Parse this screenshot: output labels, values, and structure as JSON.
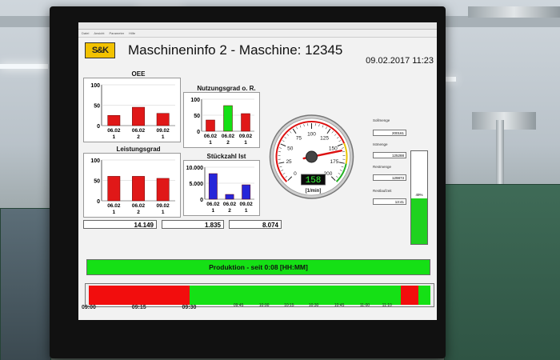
{
  "menu": [
    "Datei",
    "Ansicht",
    "Parameter",
    "Hilfe"
  ],
  "logo_text": "S&K",
  "app_title": "Maschineninfo 2 - Maschine: 12345",
  "datetime": "09.02.2017 11:23",
  "charts": [
    {
      "title": "OEE",
      "y_ticks": [
        "100",
        "50",
        "0"
      ],
      "categories": [
        "06.02\n1",
        "06.02\n2",
        "09.02\n1"
      ],
      "cat_top": [
        "06.02",
        "06.02",
        "09.02"
      ],
      "cat_bottom": [
        "1",
        "2",
        "1"
      ],
      "values": [
        25,
        45,
        30
      ],
      "color": "#e01818",
      "highlight": null
    },
    {
      "title": "Nutzungsgrad o. R.",
      "y_ticks": [
        "100",
        "50",
        "0"
      ],
      "cat_top": [
        "06.02",
        "06.02",
        "09.02"
      ],
      "cat_bottom": [
        "1",
        "2",
        "1"
      ],
      "values": [
        35,
        80,
        55
      ],
      "color": "#e01818",
      "highlight": 1
    },
    {
      "title": "Leistungsgrad",
      "y_ticks": [
        "100",
        "50",
        "0"
      ],
      "cat_top": [
        "06.02",
        "06.02",
        "09.02"
      ],
      "cat_bottom": [
        "1",
        "2",
        "1"
      ],
      "values": [
        60,
        60,
        55
      ],
      "color": "#e01818",
      "highlight": null
    },
    {
      "title": "Stückzahl Ist",
      "y_ticks": [
        "10.000",
        "5.000",
        "0"
      ],
      "cat_top": [
        "06.02",
        "06.02",
        "09.02"
      ],
      "cat_bottom": [
        "1",
        "2",
        "1"
      ],
      "values": [
        8000,
        1500,
        4500
      ],
      "color": "#2626d9",
      "highlight": null
    }
  ],
  "value_boxes": [
    "14.149",
    "1.835",
    "8.074"
  ],
  "gauge": {
    "ticks": [
      "0",
      "25",
      "50",
      "75",
      "100",
      "125",
      "150",
      "175",
      "200"
    ],
    "value_display": "158",
    "unit": "[1/min]",
    "value": 158,
    "max": 200
  },
  "right_panel": {
    "items": [
      {
        "label": "Sollmenge",
        "value": "200161"
      },
      {
        "label": "Istmenge",
        "value": "125288"
      },
      {
        "label": "Restmenge",
        "value": "129873"
      },
      {
        "label": "Restlaufzeit",
        "value": "13:41"
      }
    ],
    "percent_label": "49%",
    "percent": 49
  },
  "production_label": "Produktion  -  seit  0:08 [HH:MM]",
  "timeline": {
    "segments": [
      {
        "start": 0.0,
        "end": 0.294,
        "color": "#f20d0d"
      },
      {
        "start": 0.294,
        "end": 0.913,
        "color": "#15e015"
      },
      {
        "start": 0.913,
        "end": 0.964,
        "color": "#f20d0d"
      },
      {
        "start": 0.964,
        "end": 1.0,
        "color": "#15e015"
      }
    ],
    "major_ticks": [
      {
        "label": "09:00",
        "pos": 0.0
      },
      {
        "label": "09:15",
        "pos": 0.147
      },
      {
        "label": "09:30",
        "pos": 0.294
      }
    ],
    "minor_ticks": [
      {
        "label": "09:45",
        "pos": 0.44
      },
      {
        "label": "10:00",
        "pos": 0.515
      },
      {
        "label": "10:15",
        "pos": 0.588
      },
      {
        "label": "10:30",
        "pos": 0.66
      },
      {
        "label": "10:45",
        "pos": 0.735
      },
      {
        "label": "11:00",
        "pos": 0.81
      },
      {
        "label": "11:10",
        "pos": 0.875
      }
    ]
  },
  "colors": {
    "red": "#e01818",
    "green": "#15e015",
    "blue": "#2626d9"
  }
}
